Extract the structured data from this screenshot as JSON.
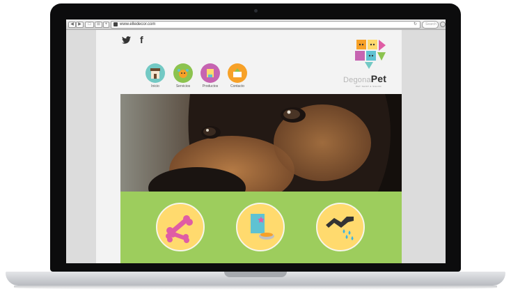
{
  "browser": {
    "url": "www.elledecor.com",
    "search_placeholder": "Search"
  },
  "site": {
    "social": {
      "twitter_glyph": "❧",
      "facebook_glyph": "f"
    },
    "nav": [
      {
        "label": "Inicio",
        "color": "#73c9c4"
      },
      {
        "label": "Servicios",
        "color": "#8cc34f"
      },
      {
        "label": "Productos",
        "color": "#c664b1"
      },
      {
        "label": "Contacto",
        "color": "#f7a128"
      }
    ],
    "logo": {
      "part1": "Degona",
      "part2": "Pet",
      "tagline": "PET SHOP & SALON"
    },
    "features": [
      {
        "icon": "bone-icon"
      },
      {
        "icon": "food-bag-icon"
      },
      {
        "icon": "shower-icon"
      }
    ],
    "colors": {
      "green_band": "#9dcd5d",
      "feature_circle": "#ffda6e",
      "bone": "#df5da5",
      "bag": "#5fc2d2",
      "water": "#3bb3e4"
    }
  }
}
